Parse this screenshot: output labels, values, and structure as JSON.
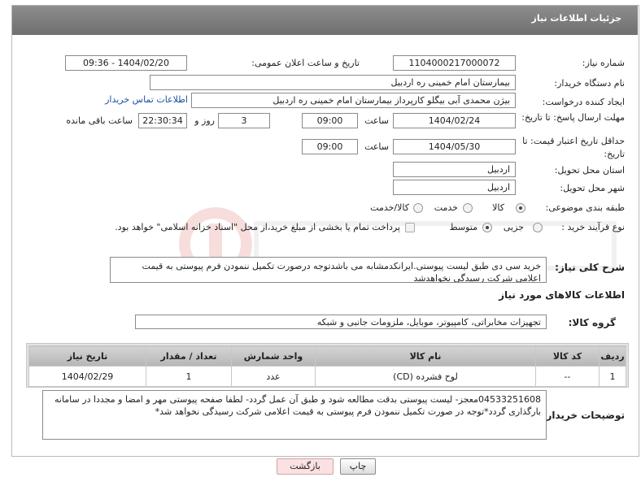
{
  "header": {
    "title": "جزئیات اطلاعات نیاز"
  },
  "fields": {
    "need_number_label": "شماره نیاز:",
    "need_number": "1104000217000072",
    "announce_label": "تاریخ و ساعت اعلان عمومی:",
    "announce_value": "1404/02/20 - 09:36",
    "buyer_org_label": "نام دستگاه خریدار:",
    "buyer_org": "بیمارستان امام خمینی  ره  اردبیل",
    "creator_label": "ایجاد کننده درخواست:",
    "creator": "بیژن محمدی آبی بیگلو کارپرداز بیمارستان امام خمینی  ره  اردبیل",
    "contact_link": "اطلاعات تماس خریدار",
    "deadline_label": "مهلت ارسال پاسخ: تا تاریخ:",
    "deadline_date": "1404/02/24",
    "time_label": "ساعت",
    "deadline_time": "09:00",
    "days_value": "3",
    "days_label": "روز و",
    "remaining_value": "22:30:34",
    "remaining_label": "ساعت باقی مانده",
    "validity_label": "حداقل تاریخ اعتبار قیمت: تا تاریخ:",
    "validity_date": "1404/05/30",
    "validity_time": "09:00",
    "province_label": "استان محل تحویل:",
    "province": "اردبیل",
    "city_label": "شهر محل تحویل:",
    "city": "اردبیل",
    "category_label": "طبقه بندی موضوعی:",
    "category_options": [
      "کالا",
      "خدمت",
      "کالا/خدمت"
    ],
    "process_label": "نوع فرآیند خرید :",
    "process_options": [
      "جزیی",
      "متوسط"
    ],
    "payment_note": "پرداخت تمام یا بخشی از مبلغ خرید،از محل \"اسناد خزانه اسلامی\" خواهد بود."
  },
  "description": {
    "label": "شرح کلی نیاز:",
    "text": "خرید سی دی طبق لیست پیوستی.ایرانکدمشابه می باشدتوجه درصورت تکمیل ننمودن فرم پیوستی به قیمت اعلامی شرکت رسیدگی نخواهدشد"
  },
  "goods": {
    "section_title": "اطلاعات کالاهای مورد نیاز",
    "group_label": "گروه کالا:",
    "group_value": "تجهیزات مخابراتی، کامپیوتر، موبایل، ملزومات جانبی و شبکه",
    "columns": [
      "ردیف",
      "کد کالا",
      "نام کالا",
      "واحد شمارش",
      "تعداد / مقدار",
      "تاریخ نیاز"
    ],
    "rows": [
      {
        "row": "1",
        "code": "--",
        "name": "لوح فشرده (CD)",
        "unit": "عدد",
        "qty": "1",
        "date": "1404/02/29"
      }
    ]
  },
  "buyer_notes": {
    "label": "توضیحات خریدار:",
    "text": "04533251608معجز- لیست پیوستی بدقت مطالعه شود و طبق آن عمل گردد- لطفا صفحه پیوستی مهر و امضا و مجددا در سامانه بارگذاری گردد*توجه در صورت تکمیل ننمودن فرم پیوستی به قیمت اعلامی شرکت رسیدگی نخواهد شد*"
  },
  "buttons": {
    "print": "چاپ",
    "back": "بازگشت"
  },
  "colors": {
    "header": "#7d7d7d",
    "link": "#1a50a0",
    "back_button": "#fbe1e1",
    "table_header": "#c4c4c4"
  }
}
